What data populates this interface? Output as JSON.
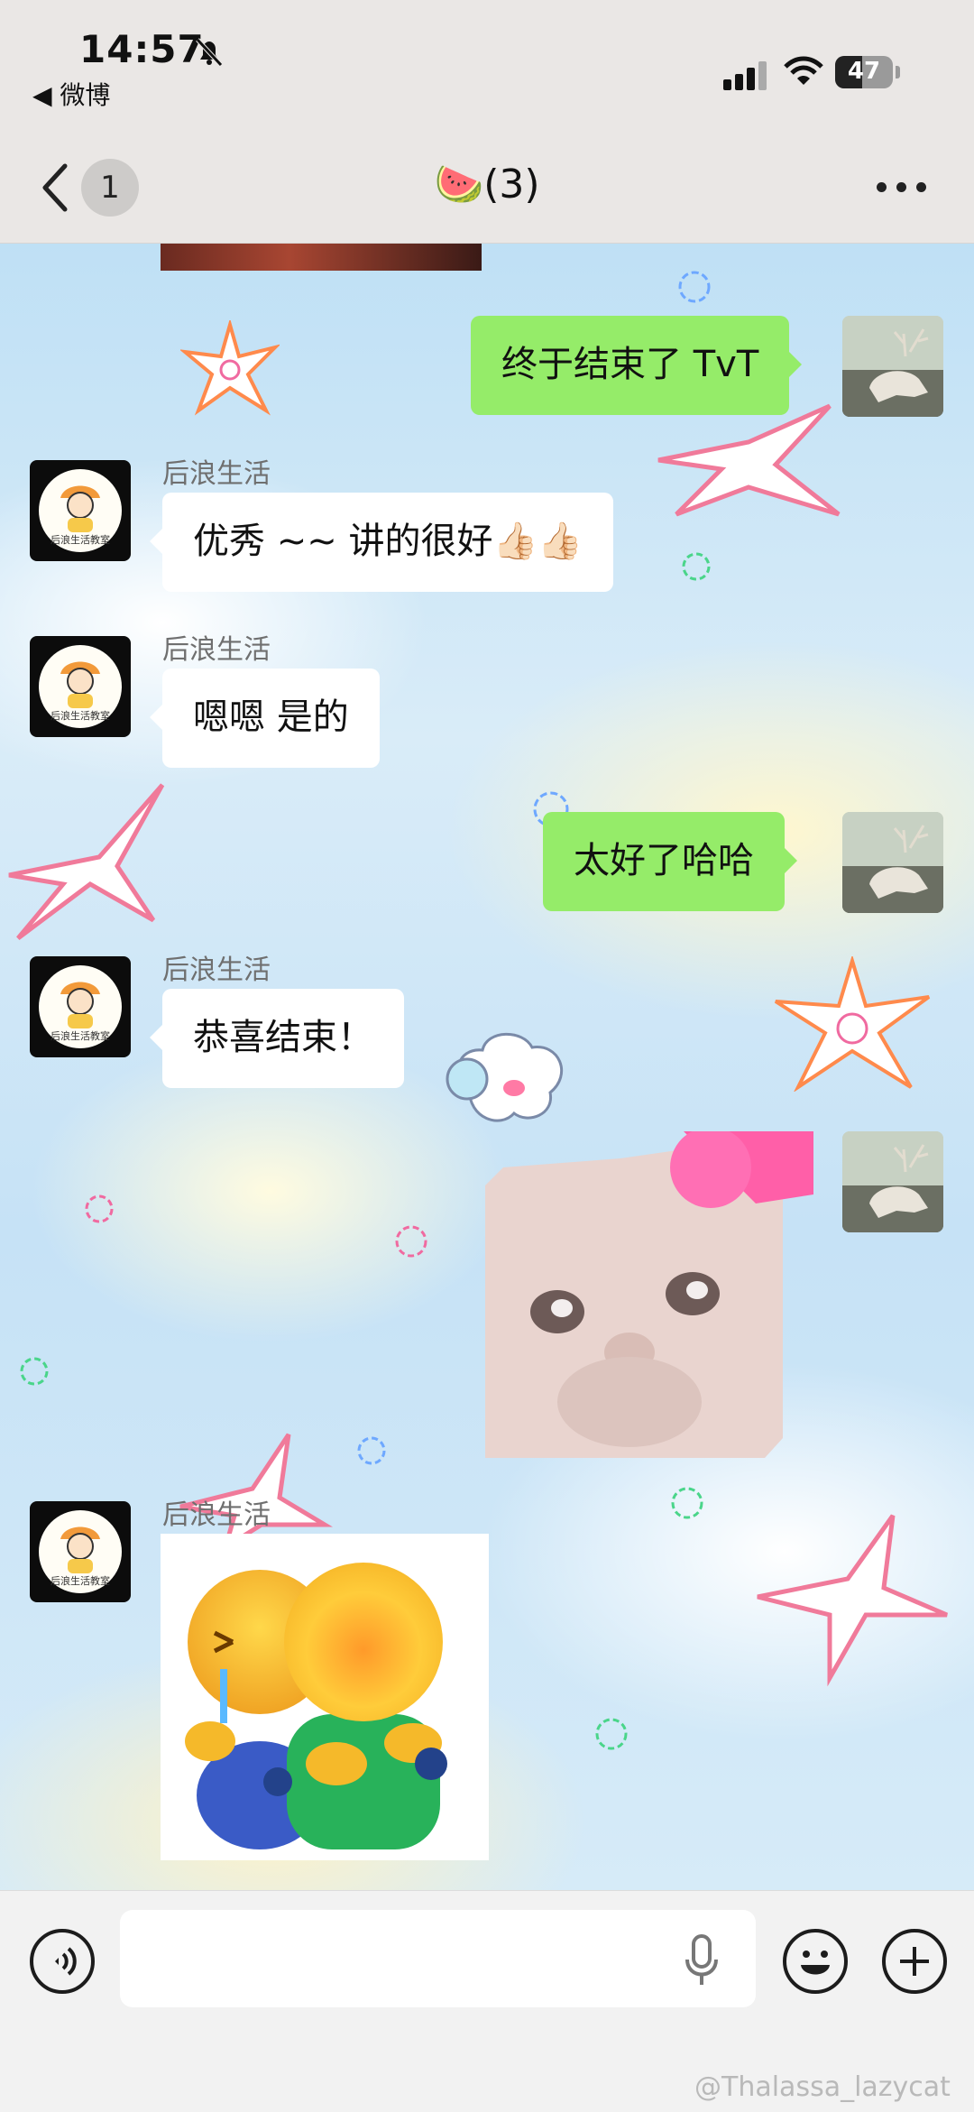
{
  "status_bar": {
    "time": "14:57",
    "back_app": "◀ 微博",
    "battery_level": "47",
    "battery_percent": 0.47
  },
  "header": {
    "unread_count": "1",
    "title": "🍉(3)",
    "back_icon": "chevron-left-icon",
    "more_icon": "more-dots-icon"
  },
  "messages": [
    {
      "side": "right",
      "type": "text",
      "text": "终于结束了 TvT"
    },
    {
      "side": "left",
      "sender": "后浪生活",
      "type": "text",
      "text": "优秀 ~~ 讲的很好👍🏻👍🏻"
    },
    {
      "side": "left",
      "sender": "后浪生活",
      "type": "text",
      "text": "嗯嗯 是的"
    },
    {
      "side": "right",
      "type": "text",
      "text": "太好了哈哈"
    },
    {
      "side": "left",
      "sender": "后浪生活",
      "type": "text",
      "text": "恭喜结束！"
    },
    {
      "side": "right",
      "type": "sticker",
      "sticker": "cat-face-sticker"
    },
    {
      "side": "left",
      "sender": "后浪生活",
      "type": "sticker",
      "sticker": "hug-emoji-sticker"
    }
  ],
  "avatar_text": "后浪生活教室",
  "input_bar": {
    "placeholder": "",
    "voice_icon": "voice-icon",
    "emoji_icon": "emoji-icon",
    "plus_icon": "plus-icon",
    "mic_icon": "mic-icon"
  },
  "watermark": "@Thalassa_lazycat",
  "colors": {
    "bubble_self": "#95ec69",
    "bubble_other": "#ffffff",
    "header_bg": "#eae7e5",
    "input_bg": "#f2f2f2"
  }
}
